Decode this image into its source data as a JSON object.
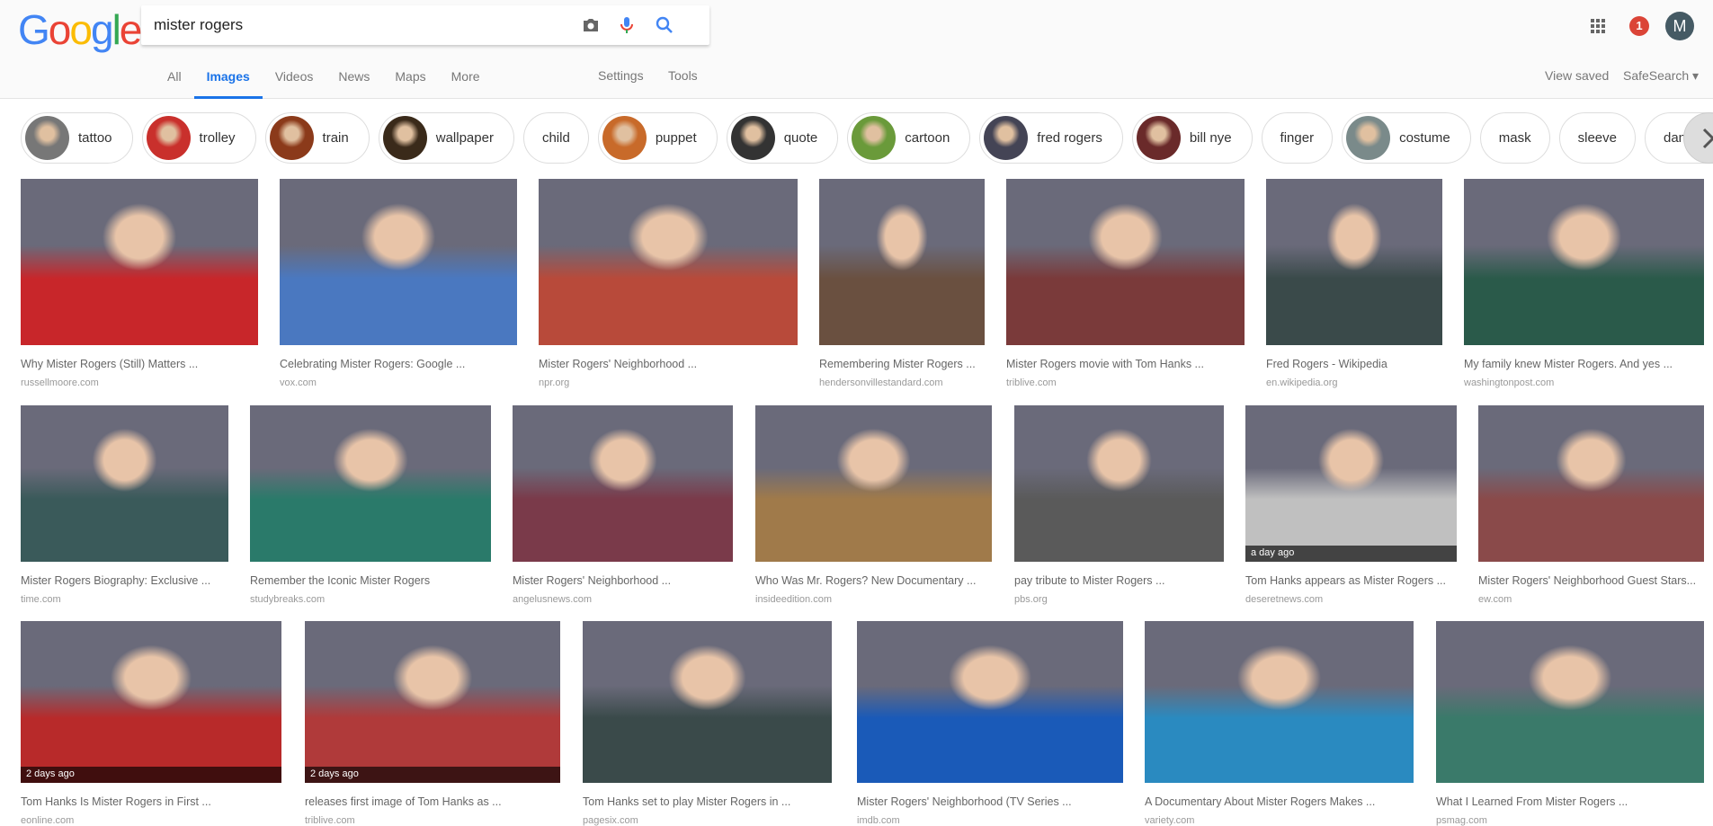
{
  "header": {
    "logo": "Google",
    "query": "mister rogers",
    "apps_icon": "apps-grid-icon",
    "notifications": "1",
    "avatar": "M",
    "accent": "#1a73e8"
  },
  "tabs": [
    {
      "label": "All"
    },
    {
      "label": "Images",
      "active": true
    },
    {
      "label": "Videos"
    },
    {
      "label": "News"
    },
    {
      "label": "Maps"
    },
    {
      "label": "More"
    }
  ],
  "tools": {
    "settings": "Settings",
    "tools": "Tools",
    "view_saved": "View saved",
    "safesearch": "SafeSearch ▾"
  },
  "chips": [
    {
      "label": "tattoo",
      "color": "#777"
    },
    {
      "label": "trolley",
      "color": "#c9302c"
    },
    {
      "label": "train",
      "color": "#8b3a1a"
    },
    {
      "label": "wallpaper",
      "color": "#3a2a1a"
    },
    {
      "label": "child"
    },
    {
      "label": "puppet",
      "color": "#c86a2a"
    },
    {
      "label": "quote",
      "color": "#333"
    },
    {
      "label": "cartoon",
      "color": "#6a9a3a"
    },
    {
      "label": "fred rogers",
      "color": "#445"
    },
    {
      "label": "bill nye",
      "color": "#6a2a2a"
    },
    {
      "label": "finger"
    },
    {
      "label": "costume",
      "color": "#7a8a8a"
    },
    {
      "label": "mask"
    },
    {
      "label": "sleeve"
    },
    {
      "label": "daniel tiger"
    }
  ],
  "results": [
    [
      {
        "caption": "Why Mister Rogers (Still) Matters ...",
        "domain": "russellmoore.com",
        "color": "#c8262a"
      },
      {
        "caption": "Celebrating Mister Rogers: Google ...",
        "domain": "vox.com",
        "color": "#4a78c0"
      },
      {
        "caption": "Mister Rogers' Neighborhood ...",
        "domain": "npr.org",
        "color": "#b84a3a"
      },
      {
        "caption": "Remembering Mister Rogers ...",
        "domain": "hendersonvillestandard.com",
        "color": "#6a5040"
      },
      {
        "caption": "Mister Rogers movie with Tom Hanks ...",
        "domain": "triblive.com",
        "color": "#7a3a3a"
      },
      {
        "caption": "Fred Rogers - Wikipedia",
        "domain": "en.wikipedia.org",
        "color": "#3a4a4a"
      },
      {
        "caption": "My family knew Mister Rogers. And yes ...",
        "domain": "washingtonpost.com",
        "color": "#2a5a4a"
      }
    ],
    [
      {
        "caption": "Mister Rogers Biography: Exclusive ...",
        "domain": "time.com",
        "color": "#3a5a5a"
      },
      {
        "caption": "Remember the Iconic Mister Rogers",
        "domain": "studybreaks.com",
        "color": "#2a7a6a"
      },
      {
        "caption": "Mister Rogers' Neighborhood ...",
        "domain": "angelusnews.com",
        "color": "#7a3a4a"
      },
      {
        "caption": "Who Was Mr. Rogers? New Documentary ...",
        "domain": "insideedition.com",
        "color": "#a07a4a"
      },
      {
        "caption": "pay tribute to Mister Rogers ...",
        "domain": "pbs.org",
        "color": "#5a5a5a"
      },
      {
        "caption": "Tom Hanks appears as Mister Rogers ...",
        "domain": "deseretnews.com",
        "color": "#c0c0c0",
        "badge": "a day ago"
      },
      {
        "caption": "Mister Rogers' Neighborhood Guest Stars...",
        "domain": "ew.com",
        "color": "#8a4a4a"
      }
    ],
    [
      {
        "caption": "Tom Hanks Is Mister Rogers in First ...",
        "domain": "eonline.com",
        "color": "#b82a2a",
        "badge": "2 days ago"
      },
      {
        "caption": "releases first image of Tom Hanks as ...",
        "domain": "triblive.com",
        "color": "#b03a3a",
        "badge": "2 days ago"
      },
      {
        "caption": "Tom Hanks set to play Mister Rogers in ...",
        "domain": "pagesix.com",
        "color": "#3a4a4a"
      },
      {
        "caption": "Mister Rogers' Neighborhood (TV Series ...",
        "domain": "imdb.com",
        "color": "#1a5ab8"
      },
      {
        "caption": "A Documentary About Mister Rogers Makes ...",
        "domain": "variety.com",
        "color": "#2a8ac0"
      },
      {
        "caption": "What I Learned From Mister Rogers ...",
        "domain": "psmag.com",
        "color": "#3a7a6a"
      }
    ]
  ]
}
